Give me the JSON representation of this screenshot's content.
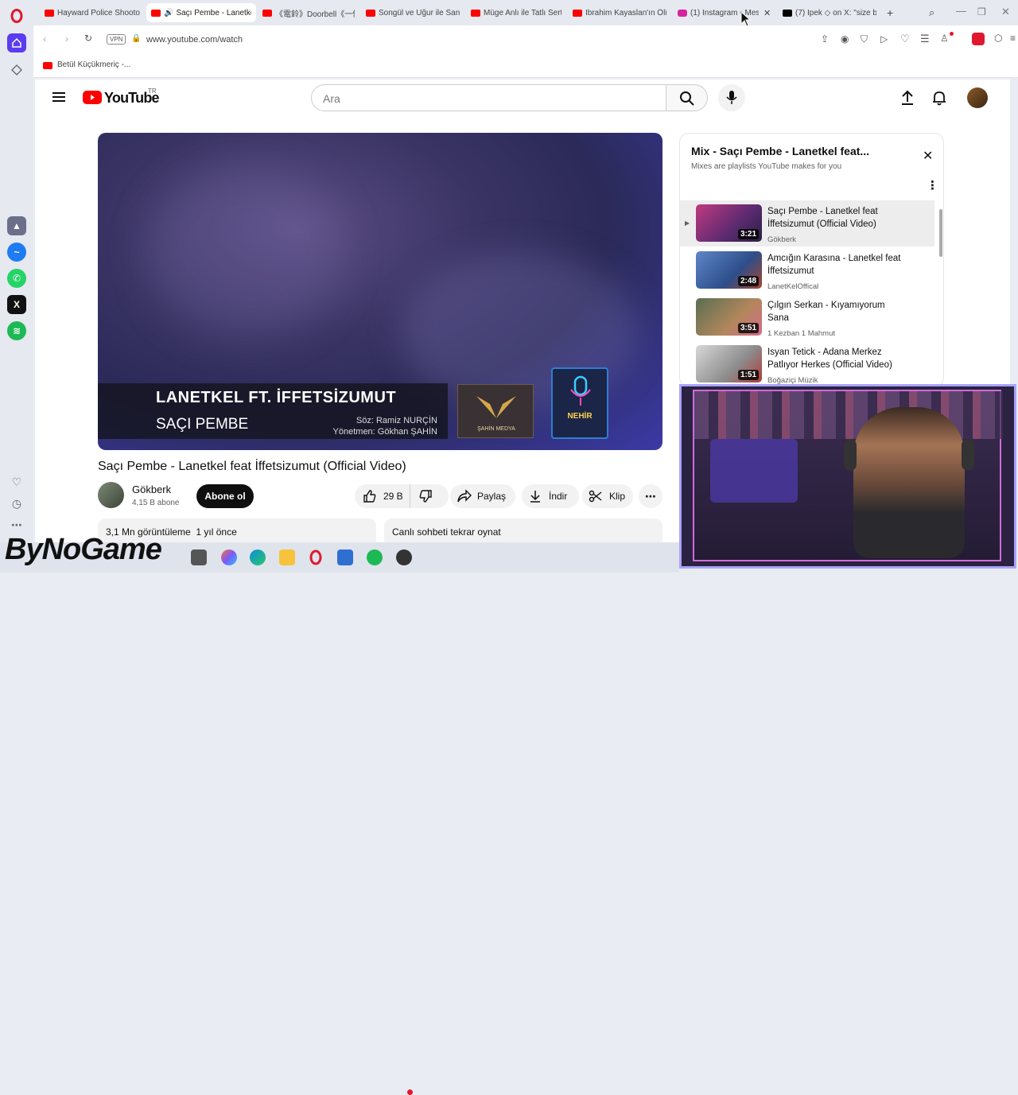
{
  "browser": {
    "tabs": [
      {
        "label": "Hayward Police Shooto",
        "favicon_color": "#ff0000"
      },
      {
        "label": "Saçı Pembe - Lanetkel",
        "favicon_color": "#ff0000",
        "active": true
      },
      {
        "label": "《電鈴》Doorbell《一個人",
        "favicon_color": "#ff0000"
      },
      {
        "label": "Songül ve Uğur ile Sanı",
        "favicon_color": "#ff0000"
      },
      {
        "label": "Müge Anlı ile Tatlı Sert",
        "favicon_color": "#ff0000"
      },
      {
        "label": "İbrahim Kayaslan'ın Ölü",
        "favicon_color": "#ff0000"
      },
      {
        "label": "(1) Instagram • Mes",
        "favicon_color": "#d6249f"
      },
      {
        "label": "(7) İpek ◇ on X: \"size bi",
        "favicon_color": "#000000"
      }
    ],
    "vpn_label": "VPN",
    "url": "www.youtube.com/watch",
    "bookmark": "Betül Küçükmeriç -..."
  },
  "youtube": {
    "logo_text": "YouTube",
    "country": "TR",
    "search_placeholder": "Ara",
    "video": {
      "overlay_title": "LANETKEL FT. İFFETSİZUMUT",
      "overlay_song": "SAÇI PEMBE",
      "overlay_credit_1": "Söz: Ramiz NURÇİN",
      "overlay_credit_2": "Yönetmen: Gökhan ŞAHİN",
      "logo_1": "ŞAHİN MEDYA",
      "logo_2": "NEHİR",
      "title": "Saçı Pembe - Lanetkel feat İffetsizumut (Official Video)"
    },
    "channel": {
      "name": "Gökberk",
      "subs": "4,15 B abone",
      "subscribe_label": "Abone ol"
    },
    "actions": {
      "likes": "29 B",
      "share": "Paylaş",
      "download": "İndir",
      "clip": "Klip"
    },
    "description": "3,1 Mn görüntüleme  1 yıl önce",
    "chat_replay": "Canlı sohbeti tekrar oynat",
    "mix": {
      "title": "Mix - Saçı Pembe - Lanetkel feat...",
      "subtitle": "Mixes are playlists YouTube makes for you",
      "items": [
        {
          "title": "Saçı Pembe - Lanetkel feat İffetsizumut (Official Video)",
          "channel": "Gökberk",
          "duration": "3:21",
          "active": true
        },
        {
          "title": "Amcığın Karasına - Lanetkel feat İffetsizumut",
          "channel": "LanetKelOffical",
          "duration": "2:48"
        },
        {
          "title": "Çılgın Serkan - Kıyamıyorum Sana",
          "channel": "1 Kezban 1 Mahmut",
          "duration": "3:51"
        },
        {
          "title": "Isyan Tetick - Adana Merkez Patlıyor Herkes (Official Video)",
          "channel": "Boğaziçi Müzik",
          "duration": "1:51"
        }
      ]
    }
  },
  "watermark": "ByNoGame"
}
